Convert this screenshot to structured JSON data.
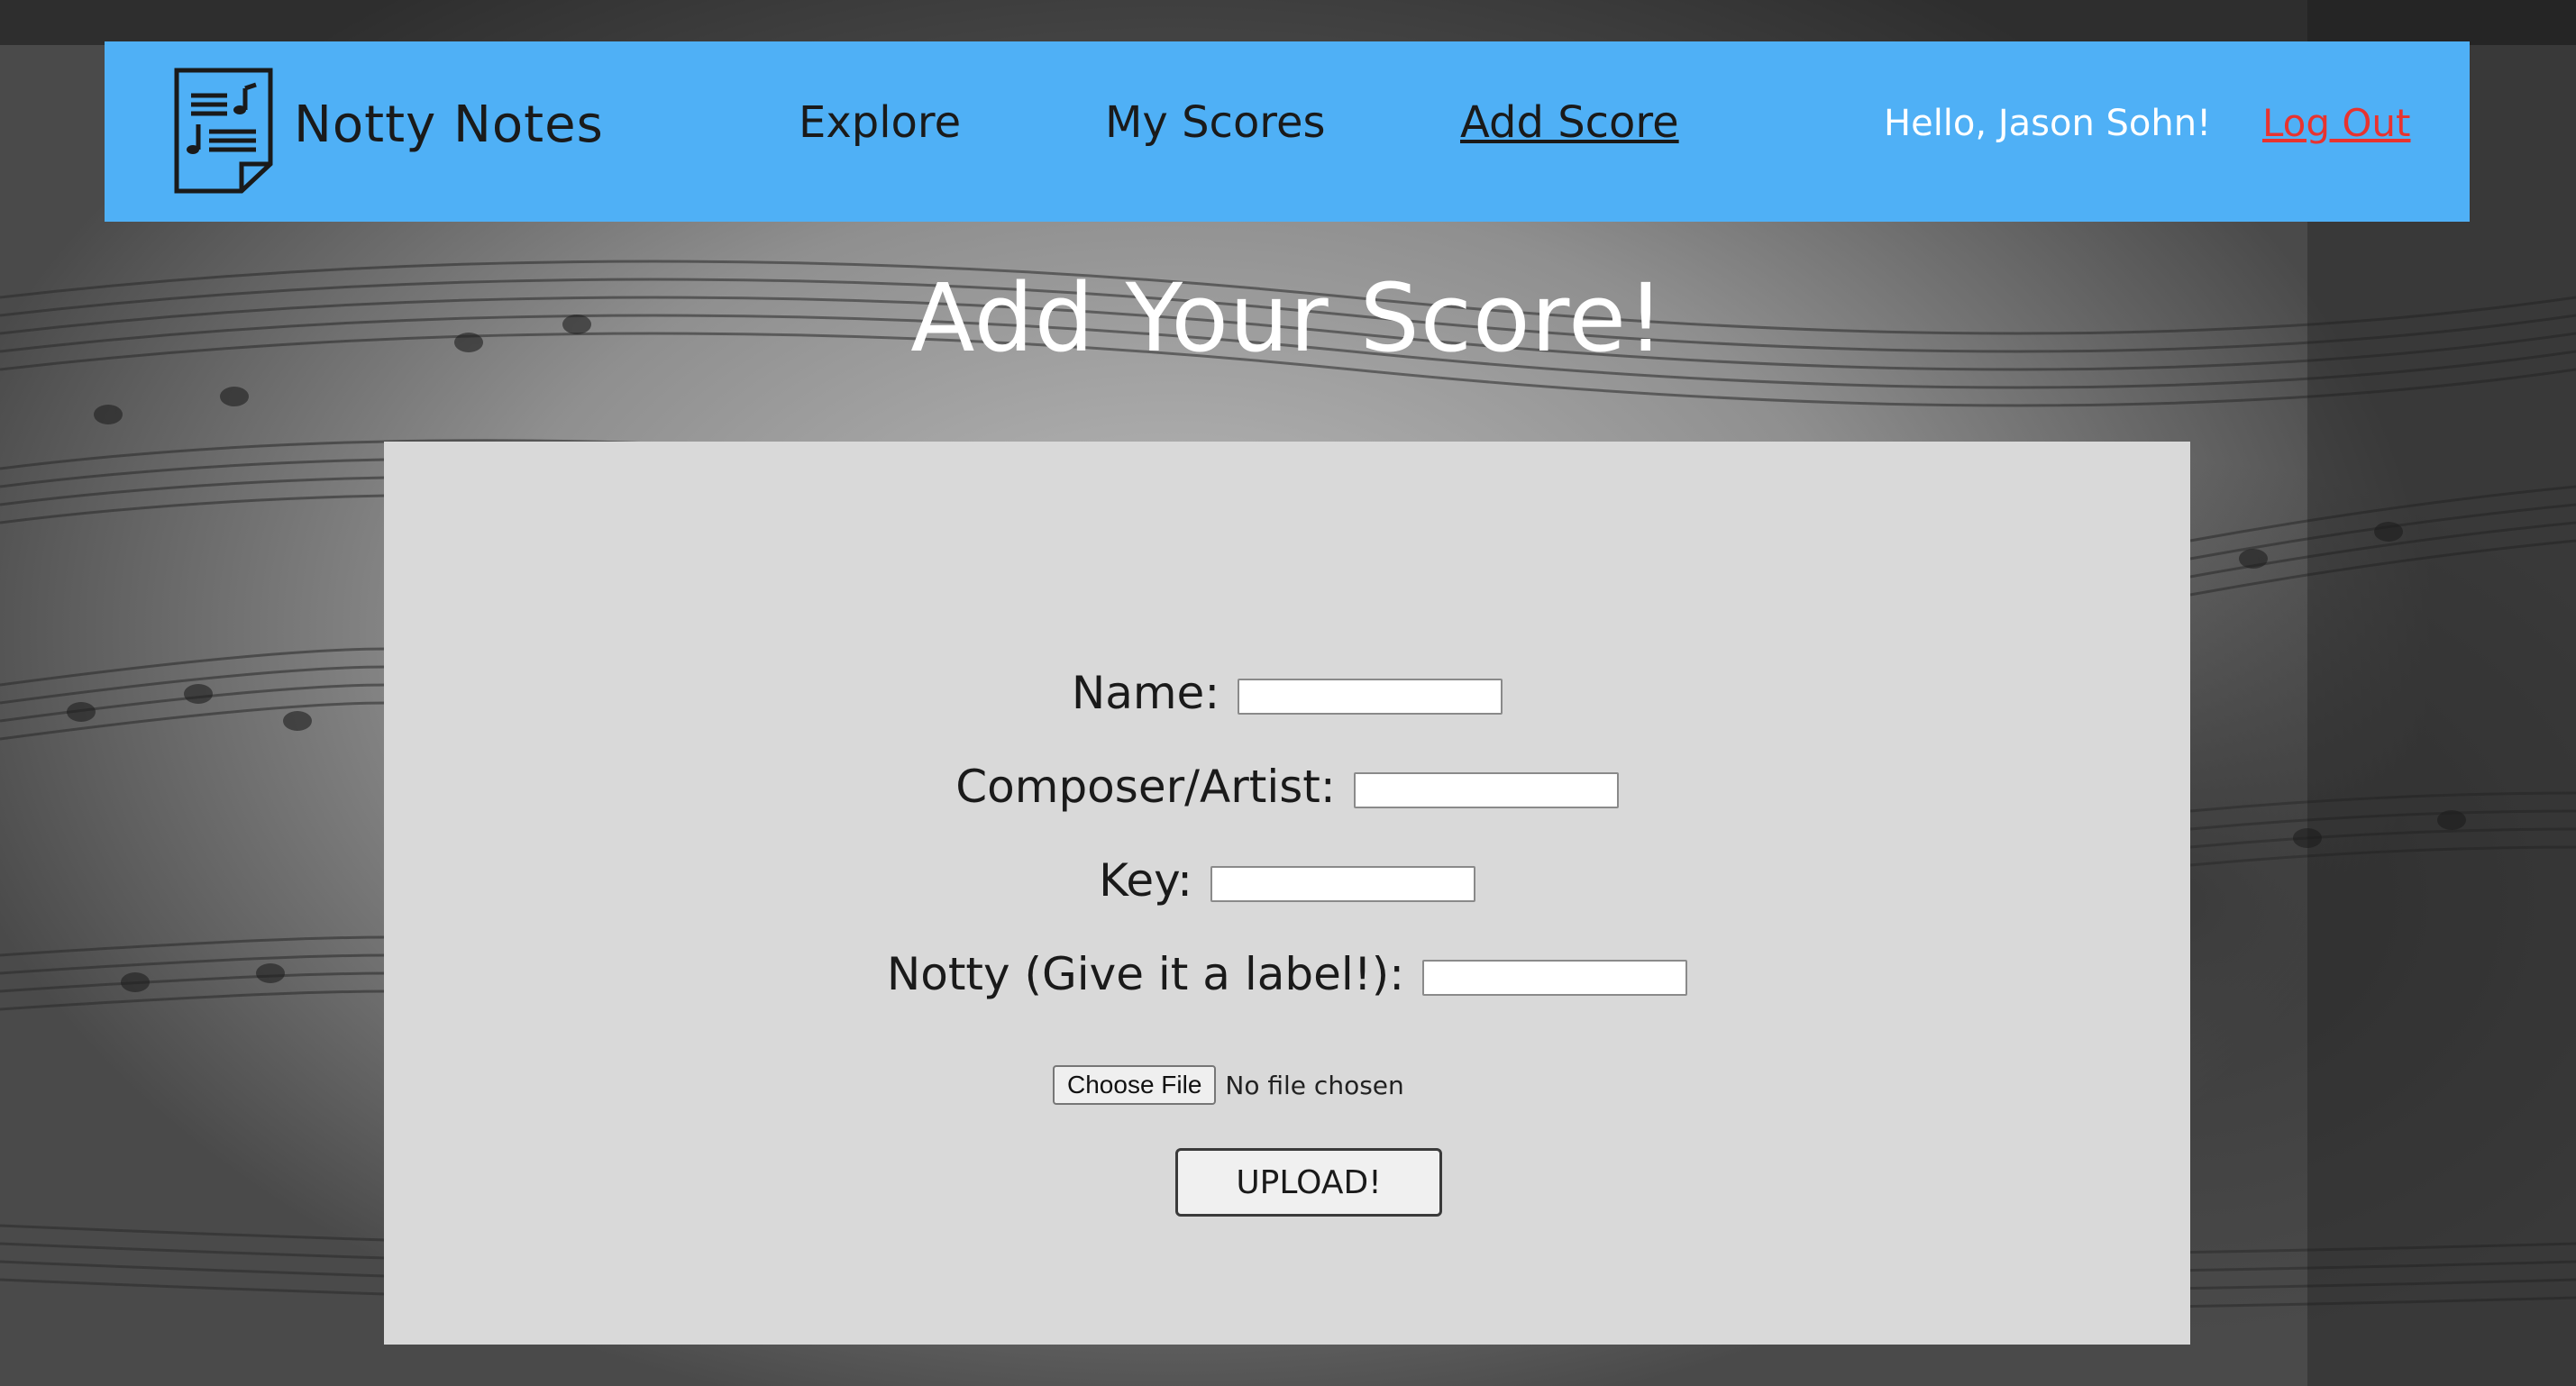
{
  "header": {
    "brand": "Notty Notes",
    "logo_icon": "sheet-music-icon",
    "nav": [
      {
        "label": "Explore",
        "active": false
      },
      {
        "label": "My Scores",
        "active": false
      },
      {
        "label": "Add Score",
        "active": true
      }
    ],
    "greeting": "Hello, Jason Sohn!",
    "logout_label": "Log Out"
  },
  "page": {
    "title": "Add Your Score!"
  },
  "form": {
    "fields": [
      {
        "label": "Name:",
        "value": ""
      },
      {
        "label": "Composer/Artist:",
        "value": ""
      },
      {
        "label": "Key:",
        "value": ""
      },
      {
        "label": "Notty (Give it a label!):",
        "value": ""
      }
    ],
    "file_button": "Choose File",
    "file_status": "No file chosen",
    "submit_label": "UPLOAD!"
  },
  "colors": {
    "nav_background": "#4fb0f6",
    "panel_background": "#d9d9d9",
    "logout": "#e8332f",
    "title": "#ffffff"
  }
}
